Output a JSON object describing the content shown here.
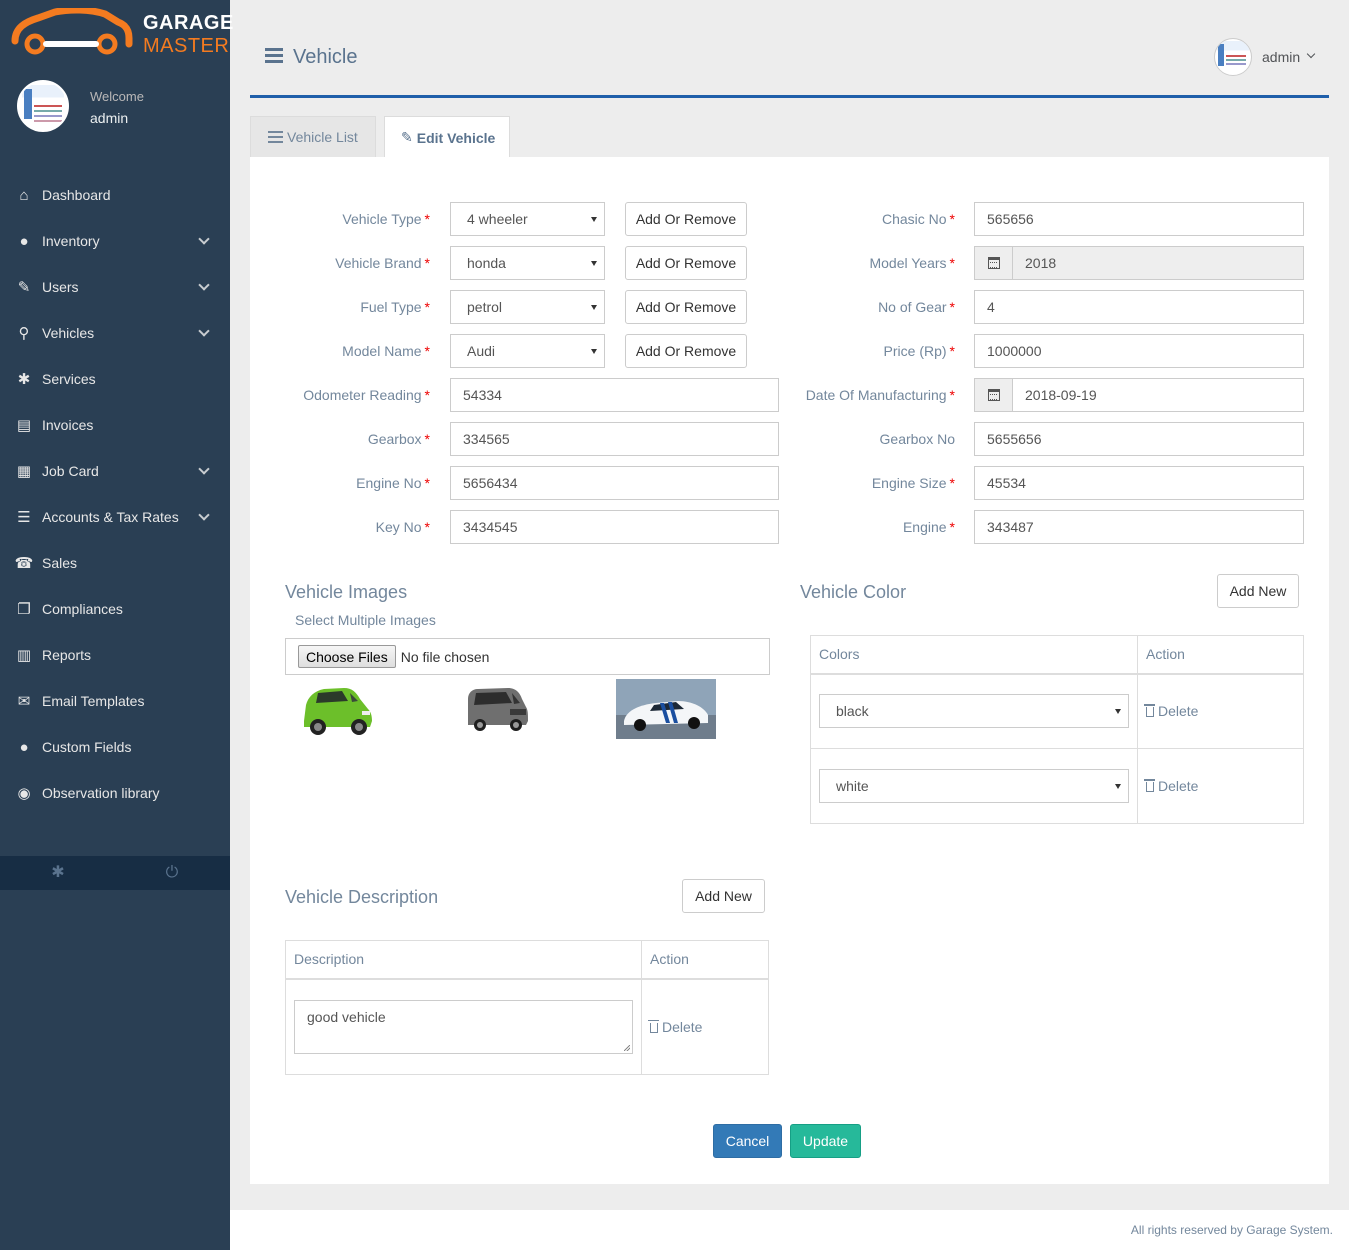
{
  "brand": {
    "line1": "GARAGE",
    "line2": "MASTER",
    "accent": "#f47b20"
  },
  "sidebar": {
    "welcome": "Welcome",
    "user": "admin",
    "items": [
      {
        "label": "Dashboard",
        "icon": "home-icon",
        "glyph": "⌂",
        "expandable": false
      },
      {
        "label": "Inventory",
        "icon": "user-icon",
        "glyph": "●",
        "expandable": true
      },
      {
        "label": "Users",
        "icon": "edit-icon",
        "glyph": "✎",
        "expandable": true
      },
      {
        "label": "Vehicles",
        "icon": "motorcycle-icon",
        "glyph": "⚲",
        "expandable": true
      },
      {
        "label": "Services",
        "icon": "cogs-icon",
        "glyph": "✱",
        "expandable": false
      },
      {
        "label": "Invoices",
        "icon": "file-text-icon",
        "glyph": "▤",
        "expandable": false
      },
      {
        "label": "Job Card",
        "icon": "table-icon",
        "glyph": "▦",
        "expandable": true
      },
      {
        "label": "Accounts & Tax Rates",
        "icon": "tasks-icon",
        "glyph": "☰",
        "expandable": true
      },
      {
        "label": "Sales",
        "icon": "tty-icon",
        "glyph": "☎",
        "expandable": false
      },
      {
        "label": "Compliances",
        "icon": "copy-icon",
        "glyph": "❐",
        "expandable": false
      },
      {
        "label": "Reports",
        "icon": "bar-chart-icon",
        "glyph": "▥",
        "expandable": false
      },
      {
        "label": "Email Templates",
        "icon": "envelope-icon",
        "glyph": "✉",
        "expandable": false
      },
      {
        "label": "Custom Fields",
        "icon": "user-icon",
        "glyph": "●",
        "expandable": false
      },
      {
        "label": "Observation library",
        "icon": "universal-access-icon",
        "glyph": "◉",
        "expandable": false
      }
    ]
  },
  "header": {
    "title": "Vehicle",
    "user": "admin"
  },
  "tabs": {
    "list": "Vehicle List",
    "edit": "Edit Vehicle"
  },
  "form": {
    "left": {
      "vehicle_type": {
        "label": "Vehicle Type",
        "value": "4 wheeler",
        "button": "Add Or Remove"
      },
      "vehicle_brand": {
        "label": "Vehicle Brand",
        "value": "honda",
        "button": "Add Or Remove"
      },
      "fuel_type": {
        "label": "Fuel Type",
        "value": "petrol",
        "button": "Add Or Remove"
      },
      "model_name": {
        "label": "Model Name",
        "value": "Audi",
        "button": "Add Or Remove"
      },
      "odometer": {
        "label": "Odometer Reading",
        "value": "54334"
      },
      "gearbox": {
        "label": "Gearbox",
        "value": "334565"
      },
      "engine_no": {
        "label": "Engine No",
        "value": "5656434"
      },
      "key_no": {
        "label": "Key No",
        "value": "3434545"
      }
    },
    "right": {
      "chasic_no": {
        "label": "Chasic No",
        "value": "565656"
      },
      "model_years": {
        "label": "Model Years",
        "value": "2018"
      },
      "no_of_gear": {
        "label": "No of Gear",
        "value": "4"
      },
      "price": {
        "label": "Price (Rp)",
        "value": "1000000"
      },
      "date_of_manufacturing": {
        "label": "Date Of Manufacturing",
        "value": "2018-09-19"
      },
      "gearbox_no": {
        "label": "Gearbox No",
        "value": "5655656"
      },
      "engine_size": {
        "label": "Engine Size",
        "value": "45534"
      },
      "engine": {
        "label": "Engine",
        "value": "343487"
      }
    }
  },
  "images": {
    "title": "Vehicle Images",
    "subtitle": "Select Multiple Images",
    "choose_label": "Choose Files",
    "file_status": "No file chosen"
  },
  "colors": {
    "title": "Vehicle Color",
    "add_label": "Add New",
    "headers": [
      "Colors",
      "Action"
    ],
    "rows": [
      {
        "value": "black",
        "action": "Delete"
      },
      {
        "value": "white",
        "action": "Delete"
      }
    ]
  },
  "description": {
    "title": "Vehicle Description",
    "add_label": "Add New",
    "headers": [
      "Description",
      "Action"
    ],
    "rows": [
      {
        "value": "good vehicle",
        "action": "Delete"
      }
    ]
  },
  "actions": {
    "cancel": "Cancel",
    "update": "Update"
  },
  "footer": {
    "text": "All rights reserved by Garage System."
  }
}
